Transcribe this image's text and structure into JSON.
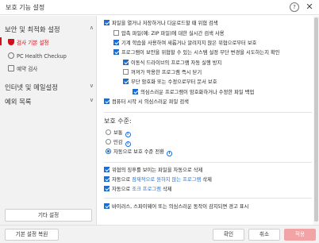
{
  "window": {
    "title": "보호 기능 설정",
    "help": "?",
    "close": "✕"
  },
  "sidebar": {
    "sections": [
      {
        "label": "보안 및 최적화 설정",
        "chevron": "∧"
      },
      {
        "label": "인터넷 및 메일설정",
        "chevron": "∨"
      },
      {
        "label": "예외 목록",
        "chevron": "∨"
      }
    ],
    "items": [
      {
        "label": "검사 기본 설정",
        "icon": "shield-icon"
      },
      {
        "label": "PC Health Checkup",
        "icon": "pc-health-icon"
      },
      {
        "label": "예약 검사",
        "icon": "calendar-icon"
      }
    ],
    "other_settings": "기타 설정"
  },
  "options": [
    {
      "label": "파일을 열거나 저장하거나 다운로드할 때 위협 검색",
      "checked": true
    },
    {
      "label": "압축 파일(예: ZIP 파일)에 대한 실시간 검색 사용",
      "checked": false
    },
    {
      "label": "기계 학습을 사용하여 새롭거나 알려지지 않은 위협으로부터 보호",
      "checked": true
    },
    {
      "label": "프로그램이 보안을 위협할 수 있는 시스템 설정 무단 변경을 시도하는지 확인",
      "checked": true
    },
    {
      "label": "이동식 드라이브의 프로그램 자동 실행 방지",
      "checked": true
    },
    {
      "label": "꺼져가 악용한 프로그램 즉시 닫기",
      "checked": false
    },
    {
      "label": "무단 암호화 또는 수정으로부터 문서 보호",
      "checked": true
    },
    {
      "label": "의심스러운 프로그램이 암호화하거나 수정한 파일 백업",
      "checked": true
    },
    {
      "label": "컴퓨터 시작 시 의심스러운 파일 검색",
      "checked": true
    }
  ],
  "protection": {
    "title": "보호 수준:",
    "levels": [
      {
        "label": "보통",
        "selected": false
      },
      {
        "label": "민감",
        "selected": false
      },
      {
        "label": "자동으로 보호 수준 전환",
        "selected": true
      }
    ]
  },
  "actions": [
    {
      "label": "위협의 징후를 보이는 파일을 자동으로 삭제",
      "prefix": "",
      "link": "",
      "suffix": "",
      "checked": true
    },
    {
      "prefix": "자동으로 ",
      "link": "잠재적으로 원하지 않는 프로그램",
      "suffix": " 삭제",
      "checked": true
    },
    {
      "prefix": "자동으로 ",
      "link": "조크 프로그램",
      "suffix": " 삭제",
      "checked": true
    }
  ],
  "alert_option": {
    "label": "바이러스, 스파이웨어 또는 의심스러운 동작이 감지되면 경고 표시",
    "checked": true
  },
  "footer": {
    "restore": "기본 설정 복원",
    "ok": "확인",
    "cancel": "취소",
    "apply": "적용"
  },
  "colors": {
    "accent": "#1a6fd4",
    "brand": "#d1101c",
    "apply_disabled": "#f1a3a6"
  }
}
